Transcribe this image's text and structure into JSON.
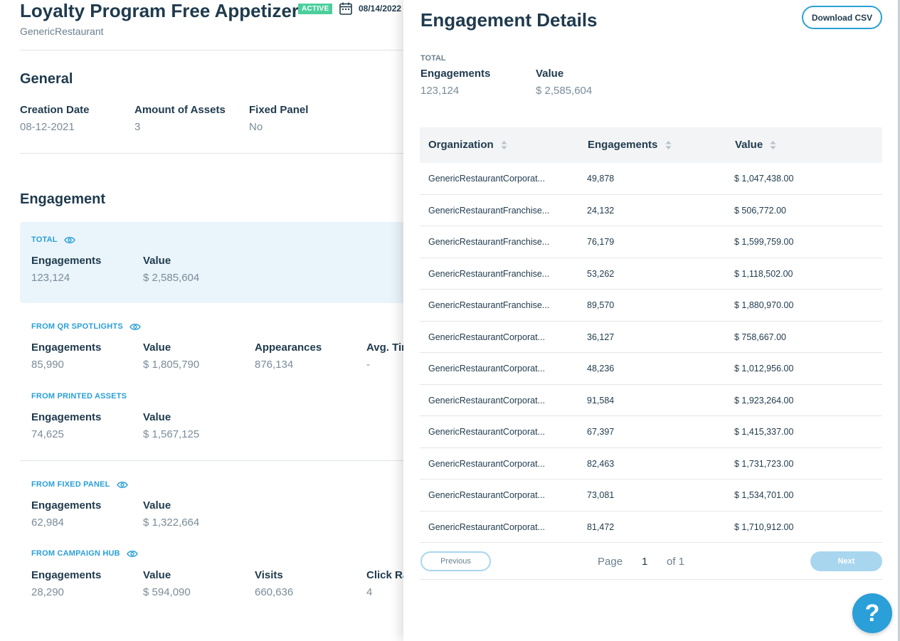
{
  "header": {
    "title": "Loyalty Program Free Appetizer",
    "status": "ACTIVE",
    "date": "08/14/2022",
    "organization": "GenericRestaurant"
  },
  "general": {
    "title": "General",
    "fields": [
      {
        "label": "Creation Date",
        "value": "08-12-2021"
      },
      {
        "label": "Amount of Assets",
        "value": "3"
      },
      {
        "label": "Fixed Panel",
        "value": "No"
      }
    ]
  },
  "engagement": {
    "title": "Engagement",
    "total": {
      "label": "TOTAL",
      "engagements_label": "Engagements",
      "engagements": "123,124",
      "value_label": "Value",
      "value": "$ 2,585,604"
    },
    "qr": {
      "label": "FROM QR SPOTLIGHTS",
      "engagements_label": "Engagements",
      "engagements": "85,990",
      "value_label": "Value",
      "value": "$ 1,805,790",
      "appearances_label": "Appearances",
      "appearances": "876,134",
      "avg_label": "Avg. Tir",
      "avg": "-"
    },
    "printed": {
      "label": "FROM PRINTED ASSETS",
      "engagements_label": "Engagements",
      "engagements": "74,625",
      "value_label": "Value",
      "value": "$ 1,567,125"
    },
    "fixed": {
      "label": "FROM FIXED PANEL",
      "engagements_label": "Engagements",
      "engagements": "62,984",
      "value_label": "Value",
      "value": "$ 1,322,664"
    },
    "hub": {
      "label": "FROM CAMPAIGN HUB",
      "engagements_label": "Engagements",
      "engagements": "28,290",
      "value_label": "Value",
      "value": "$ 594,090",
      "visits_label": "Visits",
      "visits": "660,636",
      "click_label": "Click Ra",
      "click": "4"
    }
  },
  "drawer": {
    "title": "Engagement Details",
    "download_label": "Download CSV",
    "total_label": "TOTAL",
    "engagements_label": "Engagements",
    "engagements": "123,124",
    "value_label": "Value",
    "value": "$ 2,585,604",
    "columns": [
      "Organization",
      "Engagements",
      "Value"
    ],
    "rows": [
      [
        "GenericRestaurantCorporat...",
        "49,878",
        "$ 1,047,438.00"
      ],
      [
        "GenericRestaurantFranchise...",
        "24,132",
        "$ 506,772.00"
      ],
      [
        "GenericRestaurantFranchise...",
        "76,179",
        "$ 1,599,759.00"
      ],
      [
        "GenericRestaurantFranchise...",
        "53,262",
        "$ 1,118,502.00"
      ],
      [
        "GenericRestaurantFranchise...",
        "89,570",
        "$ 1,880,970.00"
      ],
      [
        "GenericRestaurantCorporat...",
        "36,127",
        "$ 758,667.00"
      ],
      [
        "GenericRestaurantCorporat...",
        "48,236",
        "$ 1,012,956.00"
      ],
      [
        "GenericRestaurantCorporat...",
        "91,584",
        "$ 1,923,264.00"
      ],
      [
        "GenericRestaurantCorporat...",
        "67,397",
        "$ 1,415,337.00"
      ],
      [
        "GenericRestaurantCorporat...",
        "82,463",
        "$ 1,731,723.00"
      ],
      [
        "GenericRestaurantCorporat...",
        "73,081",
        "$ 1,534,701.00"
      ],
      [
        "GenericRestaurantCorporat...",
        "81,472",
        "$ 1,710,912.00"
      ]
    ],
    "pager": {
      "previous": "Previous",
      "page_word": "Page",
      "page": "1",
      "of": "of 1",
      "next": "Next"
    }
  },
  "help": {
    "label": "?"
  },
  "colors": {
    "accent": "#2a9fd8",
    "active": "#4ccf9d",
    "text": "#1f3a4d",
    "muted": "#7a8c99",
    "total_bg": "#eaf5fb"
  },
  "icons": {
    "calendar": "calendar-icon",
    "eye": "eye-icon",
    "sort": "sort-icon"
  }
}
